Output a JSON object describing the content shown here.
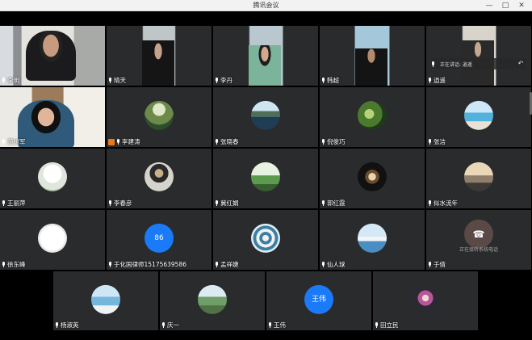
{
  "window": {
    "title": "腾讯会议",
    "minimize": "—",
    "maximize": "□",
    "close": "✕"
  },
  "tiles": {
    "r1": [
      {
        "name": "李明",
        "type": "video"
      },
      {
        "name": "晴天",
        "type": "video"
      },
      {
        "name": "李丹",
        "type": "video"
      },
      {
        "name": "韩超",
        "type": "video"
      },
      {
        "name": "逍遥",
        "type": "video",
        "speaking": "正在讲话: 逍遥"
      }
    ],
    "r2": [
      {
        "name": "范树军",
        "type": "video"
      },
      {
        "name": "李建涛",
        "type": "avatar",
        "host": true
      },
      {
        "name": "张晓春",
        "type": "avatar"
      },
      {
        "name": "倪俊巧",
        "type": "avatar"
      },
      {
        "name": "张洁",
        "type": "avatar"
      }
    ],
    "r3": [
      {
        "name": "王丽萍",
        "type": "avatar"
      },
      {
        "name": "李春彦",
        "type": "avatar"
      },
      {
        "name": "冀红娟",
        "type": "avatar"
      },
      {
        "name": "郭红霞",
        "type": "avatar"
      },
      {
        "name": "似水流年",
        "type": "avatar"
      }
    ],
    "r4": [
      {
        "name": "徐东峰",
        "type": "avatar"
      },
      {
        "name": "于化国律师15175639586",
        "type": "number",
        "avatar_text": "86"
      },
      {
        "name": "孟祥婕",
        "type": "avatar"
      },
      {
        "name": "仙人球",
        "type": "avatar"
      },
      {
        "name": "于倩",
        "type": "phone",
        "phone_text": "正在接听系统电话"
      }
    ],
    "r5": [
      {
        "name": "杨淑英",
        "type": "avatar"
      },
      {
        "name": "庆一",
        "type": "avatar"
      },
      {
        "name": "王伟",
        "type": "text",
        "avatar_text": "王伟"
      },
      {
        "name": "田立民",
        "type": "avatar"
      }
    ]
  },
  "colors": {
    "tile_bg": "#2a2b2d",
    "accent_blue": "#1a7af8",
    "host_badge": "#e8791c"
  }
}
